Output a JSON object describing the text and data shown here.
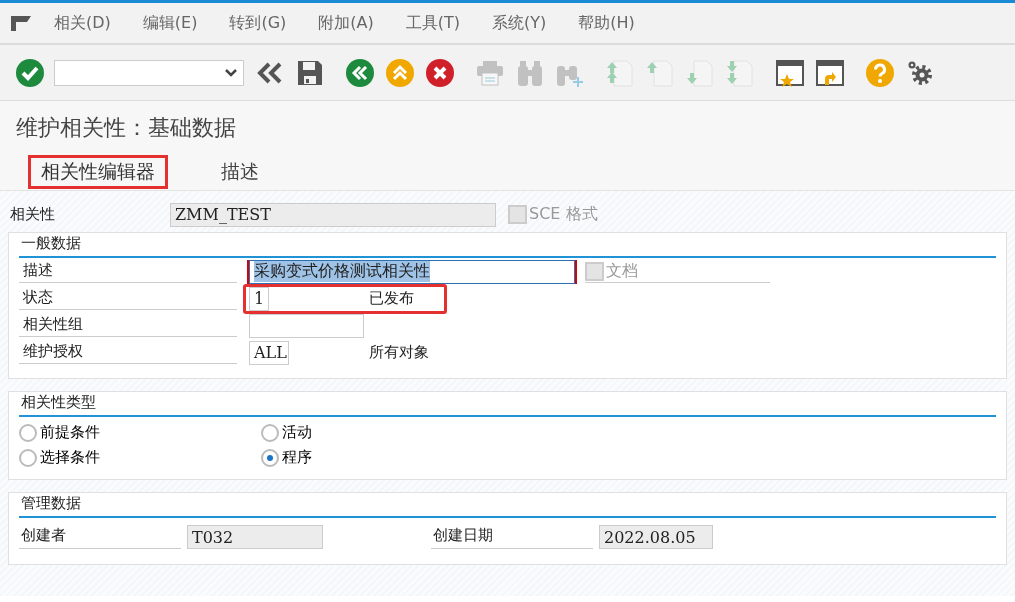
{
  "menu_bar": {
    "items": [
      "相关(D)",
      "编辑(E)",
      "转到(G)",
      "附加(A)",
      "工具(T)",
      "系统(Y)",
      "帮助(H)"
    ]
  },
  "toolbar": {
    "buttons": [
      {
        "kind": "enter",
        "disabled": false
      },
      {
        "kind": "collapse",
        "disabled": false
      },
      {
        "kind": "save",
        "disabled": false
      },
      {
        "kind": "back",
        "disabled": false
      },
      {
        "kind": "exit",
        "disabled": false
      },
      {
        "kind": "cancel",
        "disabled": false
      },
      {
        "kind": "print",
        "disabled": true
      },
      {
        "kind": "find",
        "disabled": true
      },
      {
        "kind": "find-next",
        "disabled": true
      },
      {
        "kind": "first-page",
        "disabled": true
      },
      {
        "kind": "prev-page",
        "disabled": true
      },
      {
        "kind": "next-page",
        "disabled": true
      },
      {
        "kind": "last-page",
        "disabled": true
      },
      {
        "kind": "new-session",
        "disabled": false
      },
      {
        "kind": "shortcut",
        "disabled": false
      },
      {
        "kind": "help",
        "disabled": false
      },
      {
        "kind": "settings",
        "disabled": false
      }
    ]
  },
  "title": "维护相关性：基础数据",
  "tabs": [
    {
      "label": "相关性编辑器",
      "selected": true,
      "highlighted": true
    },
    {
      "label": "描述",
      "selected": false,
      "highlighted": false
    }
  ],
  "dependency": {
    "label": "相关性",
    "value": "ZMM_TEST",
    "checkbox": {
      "label": "SCE 格式",
      "checked": false,
      "disabled": true
    }
  },
  "general_data": {
    "title": "一般数据",
    "rows": [
      {
        "kind": "field",
        "label": "描述",
        "value": "采购变式价格测试相关性",
        "text_selected": true,
        "focused": true,
        "checkbox": {
          "label": "文档",
          "checked": false,
          "disabled": true
        }
      },
      {
        "kind": "field",
        "label": "状态",
        "value": "1",
        "description": "已发布",
        "highlighted": true
      },
      {
        "kind": "field",
        "label": "相关性组",
        "value": ""
      },
      {
        "kind": "field",
        "label": "维护授权",
        "value": "ALL",
        "description": "所有对象"
      }
    ]
  },
  "dependency_type": {
    "title": "相关性类型",
    "options": [
      {
        "label": "前提条件",
        "selected": false
      },
      {
        "label": "活动",
        "selected": false
      },
      {
        "label": "选择条件",
        "selected": false
      },
      {
        "label": "程序",
        "selected": true
      }
    ]
  },
  "admin_data": {
    "title": "管理数据",
    "fields": [
      {
        "label": "创建者",
        "value": "T032"
      },
      {
        "label": "创建日期",
        "value": "2022.08.05"
      }
    ]
  }
}
